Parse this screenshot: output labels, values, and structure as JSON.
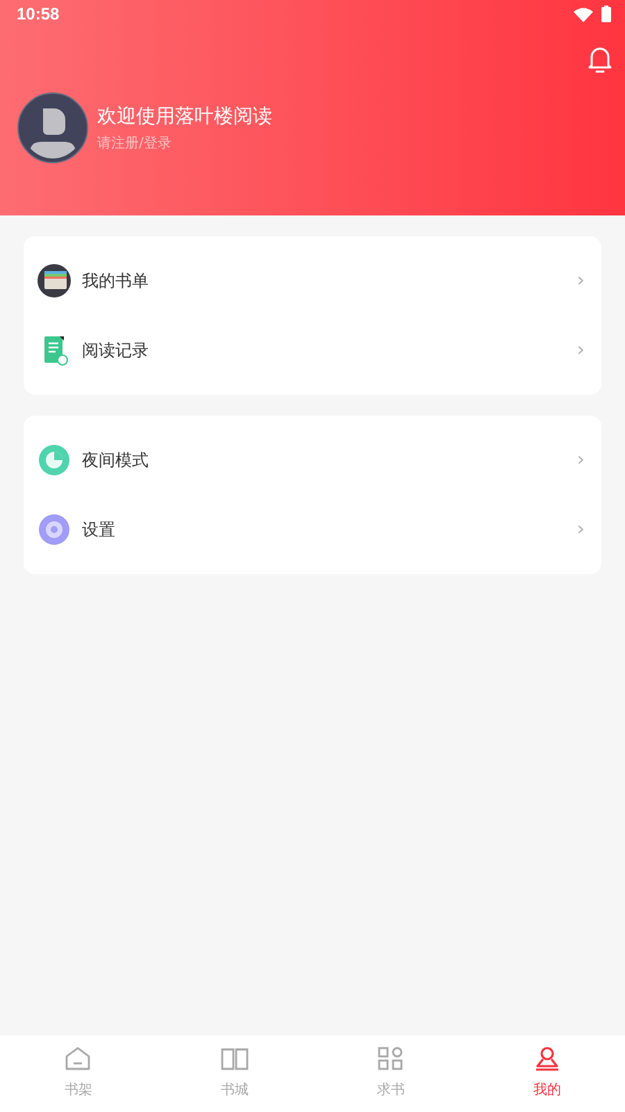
{
  "status_bar": {
    "time": "10:58"
  },
  "profile": {
    "title": "欢迎使用落叶楼阅读",
    "subtitle": "请注册/登录"
  },
  "menu_groups": [
    {
      "items": [
        {
          "kind": "booklist",
          "label": "我的书单",
          "chevron": "›"
        },
        {
          "kind": "history",
          "label": "阅读记录",
          "chevron": "›"
        }
      ]
    },
    {
      "items": [
        {
          "kind": "night",
          "label": "夜间模式",
          "chevron": "›"
        },
        {
          "kind": "settings",
          "label": "设置",
          "chevron": "›"
        }
      ]
    }
  ],
  "bottom_nav": [
    {
      "kind": "home",
      "label": "书架",
      "selected": false
    },
    {
      "kind": "book",
      "label": "书城",
      "selected": false
    },
    {
      "kind": "grid",
      "label": "求书",
      "selected": false
    },
    {
      "kind": "person",
      "label": "我的",
      "selected": true
    }
  ]
}
